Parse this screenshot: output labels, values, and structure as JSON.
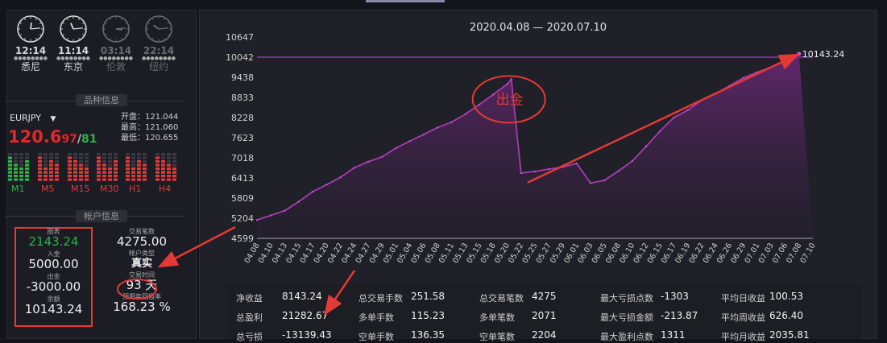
{
  "clocks": [
    {
      "time": "12:14",
      "city": "悉尼",
      "active": true,
      "hour": 12,
      "minute": 14
    },
    {
      "time": "11:14",
      "city": "东京",
      "active": true,
      "hour": 11,
      "minute": 14
    },
    {
      "time": "03:14",
      "city": "伦敦",
      "active": false,
      "hour": 3,
      "minute": 14
    },
    {
      "time": "22:14",
      "city": "纽约",
      "active": false,
      "hour": 22,
      "minute": 14
    }
  ],
  "clock_dots": "●●●●●●●●",
  "sections": {
    "instrument": "品种信息",
    "account": "帐户信息"
  },
  "instrument": {
    "symbol": "EURJPY",
    "dropdown": "▼",
    "bid_main": "120.6",
    "bid_small": "97",
    "slash": "/",
    "ask_small": "81",
    "open_label": "开盘：121.044",
    "high_label": "最高：121.060",
    "low_label": "最低：120.655",
    "timeframes": [
      {
        "label": "M1",
        "trend": "up"
      },
      {
        "label": "M5",
        "trend": "down"
      },
      {
        "label": "M15",
        "trend": "down"
      },
      {
        "label": "M30",
        "trend": "down"
      },
      {
        "label": "H1",
        "trend": "down"
      },
      {
        "label": "H4",
        "trend": "down"
      }
    ]
  },
  "account": {
    "equity_label": "图表",
    "equity": "2143.24",
    "deposit_label": "入金",
    "deposit": "5000.00",
    "withdraw_label": "出金",
    "withdraw": "-3000.00",
    "balance_label": "余额",
    "balance": "10143.24",
    "trades_label": "交易笔数",
    "trades": "4275.00",
    "account_type_label": "帐户类型",
    "account_type": "真实",
    "trade_time_label": "交易时间",
    "trade_time": "93 天",
    "annual_label": "预期年回报率",
    "annual": "168.23 %"
  },
  "chart_data": {
    "type": "area",
    "title": "2020.04.08 — 2020.07.10",
    "annotation": "出金",
    "end_label": "10143.24",
    "yticks": [
      "10647",
      "10042",
      "9438",
      "8833",
      "8228",
      "7623",
      "7018",
      "6413",
      "5809",
      "5204",
      "4599"
    ],
    "ylim": [
      4599,
      10647
    ],
    "reference_line": 10042,
    "xticks": [
      "04.08",
      "04.10",
      "04.13",
      "04.15",
      "04.17",
      "04.20",
      "04.22",
      "04.24",
      "04.27",
      "04.29",
      "05.01",
      "05.04",
      "05.06",
      "05.08",
      "05.11",
      "05.13",
      "05.15",
      "05.18",
      "05.20",
      "05.22",
      "05.25",
      "05.27",
      "05.29",
      "06.01",
      "06.03",
      "06.05",
      "06.08",
      "06.10",
      "06.12",
      "06.15",
      "06.17",
      "06.19",
      "06.22",
      "06.24",
      "06.26",
      "06.29",
      "07.01",
      "07.03",
      "07.06",
      "07.08",
      "07.10"
    ],
    "x": [
      0,
      1,
      2,
      3,
      4,
      5,
      6,
      7,
      8,
      9,
      10,
      11,
      12,
      13,
      14,
      15,
      16,
      17,
      18,
      18.3,
      19,
      20,
      21,
      22,
      23,
      24,
      25,
      26,
      27,
      28,
      29,
      30,
      31,
      32,
      33,
      34,
      35,
      36,
      37,
      38,
      39,
      40
    ],
    "values": [
      5150,
      5290,
      5430,
      5700,
      6000,
      6210,
      6430,
      6720,
      6900,
      7050,
      7310,
      7520,
      7720,
      7930,
      8090,
      8330,
      8620,
      8920,
      9230,
      9380,
      6560,
      6610,
      6680,
      6740,
      6850,
      6260,
      6340,
      6620,
      6920,
      7360,
      7820,
      8230,
      8450,
      8750,
      8950,
      9180,
      9420,
      9590,
      9740,
      9940,
      10143
    ]
  },
  "stats": [
    [
      {
        "label": "净收益",
        "value": "8143.24"
      },
      {
        "label": "总交易手数",
        "value": "251.58"
      },
      {
        "label": "总交易笔数",
        "value": "4275"
      },
      {
        "label": "最大亏损点数",
        "value": "-1303"
      },
      {
        "label": "平均日收益",
        "value": "100.53"
      }
    ],
    [
      {
        "label": "总盈利",
        "value": "21282.67"
      },
      {
        "label": "多单手数",
        "value": "115.23"
      },
      {
        "label": "多单笔数",
        "value": "2071"
      },
      {
        "label": "最大亏损金额",
        "value": "-213.87"
      },
      {
        "label": "平均周收益",
        "value": "626.40"
      }
    ],
    [
      {
        "label": "总亏损",
        "value": "-13139.43"
      },
      {
        "label": "空单手数",
        "value": "136.35"
      },
      {
        "label": "空单笔数",
        "value": "2204"
      },
      {
        "label": "最大盈利点数",
        "value": "1311"
      },
      {
        "label": "平均月收益",
        "value": "2035.81"
      }
    ]
  ],
  "colors": {
    "accent": "#a83bb0",
    "annotation": "#e53935",
    "up": "#2fb24a",
    "down": "#e03c3c"
  }
}
